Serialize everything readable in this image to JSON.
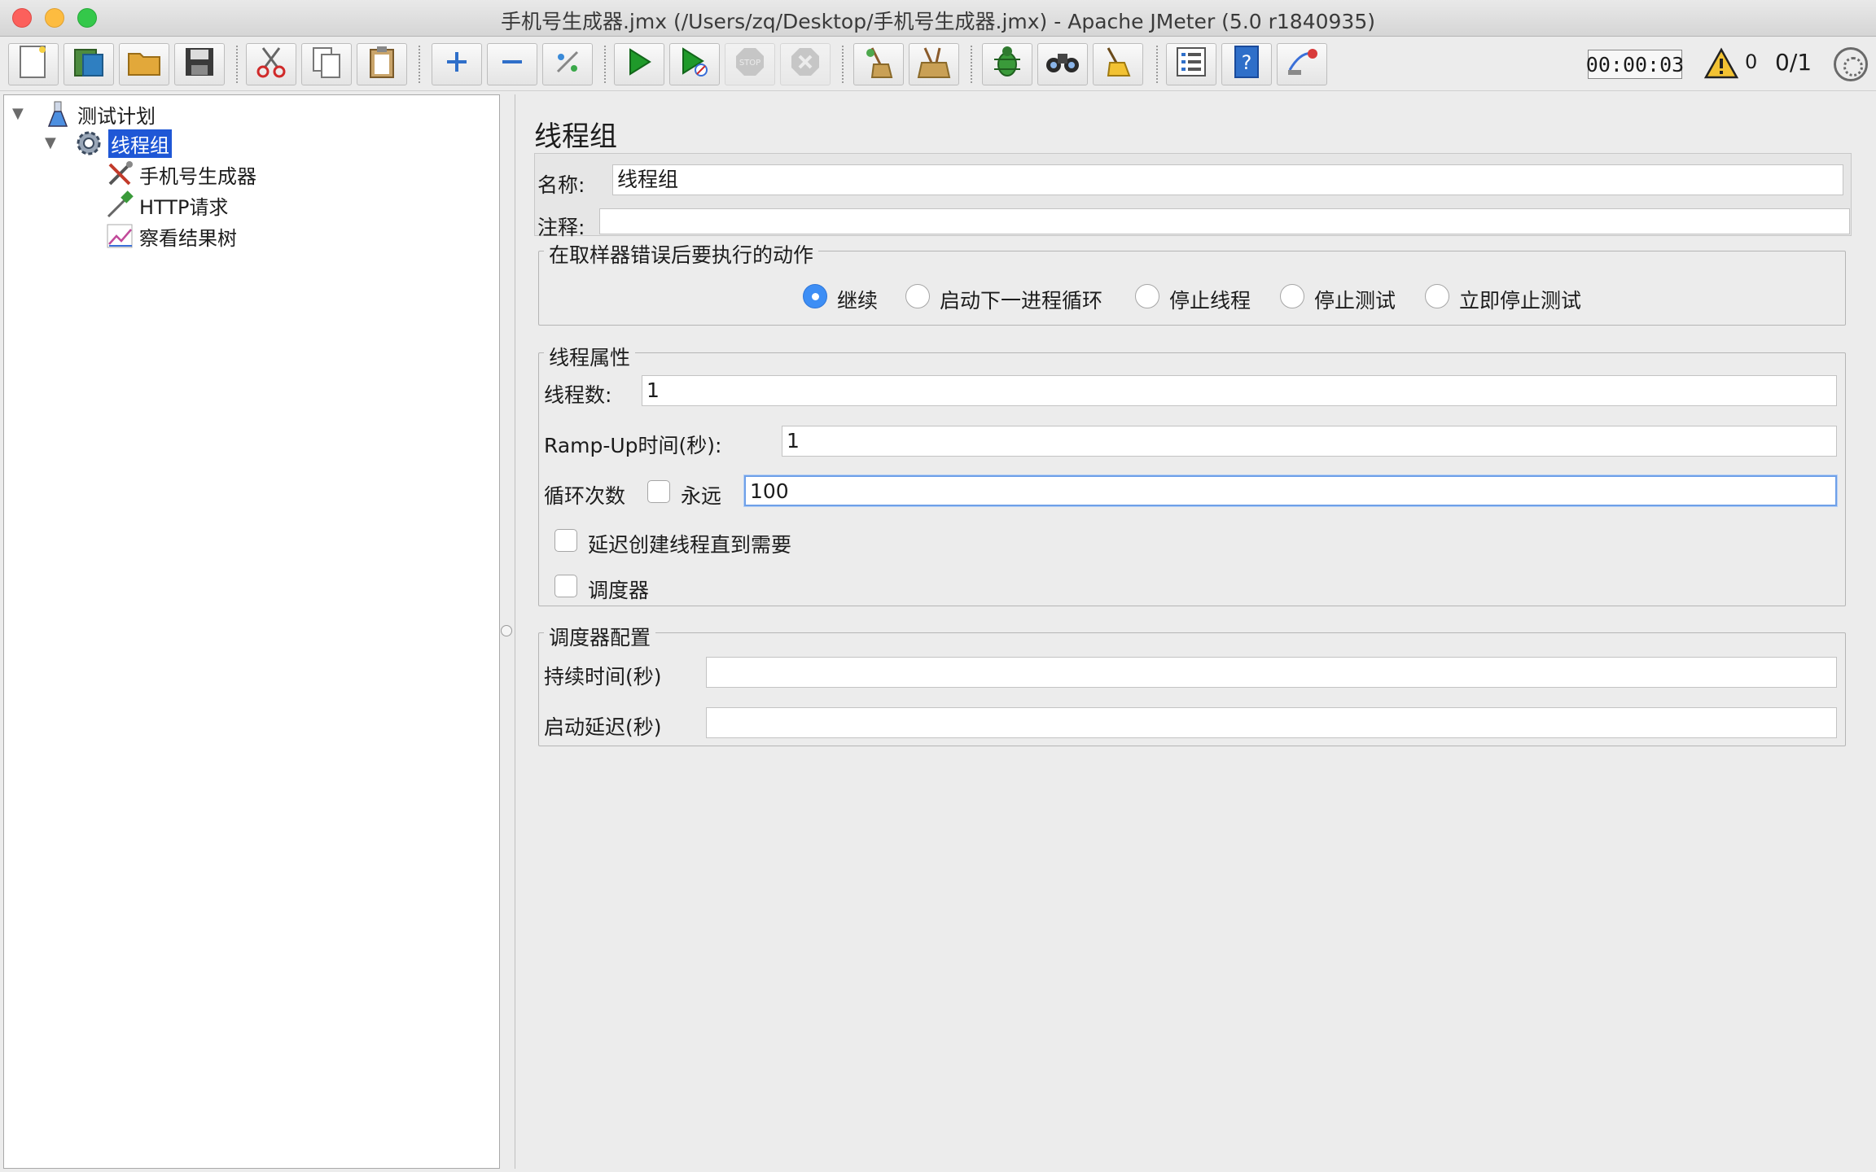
{
  "window": {
    "title": "手机号生成器.jmx (/Users/zq/Desktop/手机号生成器.jmx) - Apache JMeter (5.0 r1840935)"
  },
  "toolbar": {
    "buttons": [
      {
        "name": "new",
        "icon": "new-document-icon"
      },
      {
        "name": "templates",
        "icon": "templates-icon"
      },
      {
        "name": "open",
        "icon": "open-folder-icon"
      },
      {
        "name": "save",
        "icon": "save-icon"
      },
      {
        "name": "cut",
        "icon": "scissors-icon"
      },
      {
        "name": "copy",
        "icon": "copy-icon"
      },
      {
        "name": "paste",
        "icon": "paste-icon"
      },
      {
        "name": "expand",
        "icon": "plus-icon"
      },
      {
        "name": "collapse",
        "icon": "minus-icon"
      },
      {
        "name": "toggle",
        "icon": "toggle-icon"
      },
      {
        "name": "start",
        "icon": "play-icon"
      },
      {
        "name": "start-no-pause",
        "icon": "play-no-timers-icon"
      },
      {
        "name": "stop",
        "icon": "stop-icon"
      },
      {
        "name": "shutdown",
        "icon": "shutdown-icon"
      },
      {
        "name": "clear",
        "icon": "broom-icon"
      },
      {
        "name": "clear-all",
        "icon": "broom-all-icon"
      },
      {
        "name": "function-helper",
        "icon": "bug-icon"
      },
      {
        "name": "search",
        "icon": "binoculars-icon"
      },
      {
        "name": "reset-search",
        "icon": "broom-search-icon"
      },
      {
        "name": "log-viewer",
        "icon": "list-icon"
      },
      {
        "name": "help",
        "icon": "help-book-icon"
      },
      {
        "name": "remote",
        "icon": "remote-icon"
      }
    ],
    "timer": "00:00:03",
    "warning_count": "0",
    "thread_count": "0/1"
  },
  "tree": {
    "items": [
      {
        "label": "测试计划",
        "icon": "flask-icon"
      },
      {
        "label": "线程组",
        "icon": "gear-icon"
      },
      {
        "label": "手机号生成器",
        "icon": "tools-icon"
      },
      {
        "label": "HTTP请求",
        "icon": "pipette-icon"
      },
      {
        "label": "察看结果树",
        "icon": "chart-icon"
      }
    ]
  },
  "panel": {
    "title": "线程组",
    "name_label": "名称:",
    "name_value": "线程组",
    "comment_label": "注释:",
    "comment_value": "",
    "error_action": {
      "title": "在取样器错误后要执行的动作",
      "options": [
        "继续",
        "启动下一进程循环",
        "停止线程",
        "停止测试",
        "立即停止测试"
      ],
      "selected": "继续"
    },
    "thread_props": {
      "title": "线程属性",
      "threads_label": "线程数:",
      "threads_value": "1",
      "rampup_label": "Ramp-Up时间(秒):",
      "rampup_value": "1",
      "loop_label": "循环次数",
      "forever_label": "永远",
      "forever_checked": false,
      "loop_value": "100",
      "delay_label": "延迟创建线程直到需要",
      "delay_checked": false,
      "scheduler_label": "调度器",
      "scheduler_checked": false
    },
    "scheduler_config": {
      "title": "调度器配置",
      "duration_label": "持续时间(秒)",
      "duration_value": "",
      "startup_delay_label": "启动延迟(秒)",
      "startup_delay_value": ""
    }
  }
}
